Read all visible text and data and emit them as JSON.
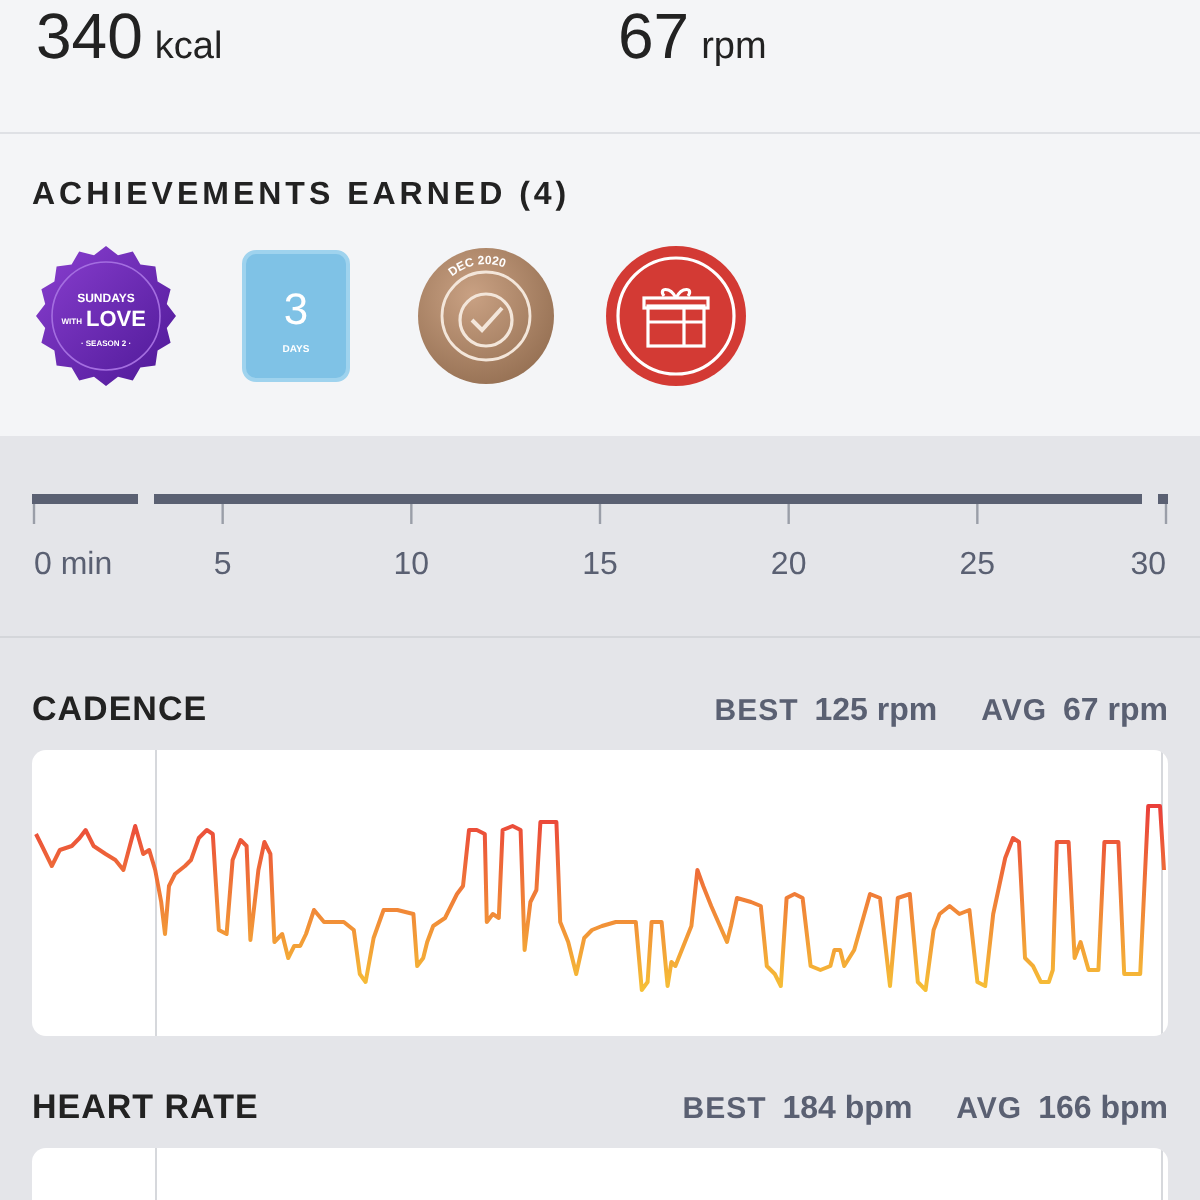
{
  "stats": [
    {
      "value": "340",
      "unit": "kcal"
    },
    {
      "value": "67",
      "unit": "rpm"
    }
  ],
  "achievements": {
    "title": "ACHIEVEMENTS EARNED (4)",
    "badges": [
      {
        "kind": "scallop",
        "lines": [
          "SUNDAYS",
          "WITH",
          "LOVE",
          "· SEASON 2 ·"
        ]
      },
      {
        "kind": "calendar",
        "lines": [
          "3",
          "DAYS"
        ]
      },
      {
        "kind": "medal",
        "lines": [
          "DEC 2020"
        ]
      },
      {
        "kind": "gift"
      }
    ]
  },
  "timeline": {
    "ticks": [
      "0 min",
      "5",
      "10",
      "15",
      "20",
      "25",
      "30"
    ]
  },
  "metrics": [
    {
      "kind": "cadence",
      "title": "CADENCE",
      "best_label": "BEST",
      "best": "125 rpm",
      "avg_label": "AVG",
      "avg": "67 rpm"
    },
    {
      "kind": "heart",
      "title": "HEART RATE",
      "best_label": "BEST",
      "best": "184 bpm",
      "avg_label": "AVG",
      "avg": "166 bpm"
    }
  ]
}
